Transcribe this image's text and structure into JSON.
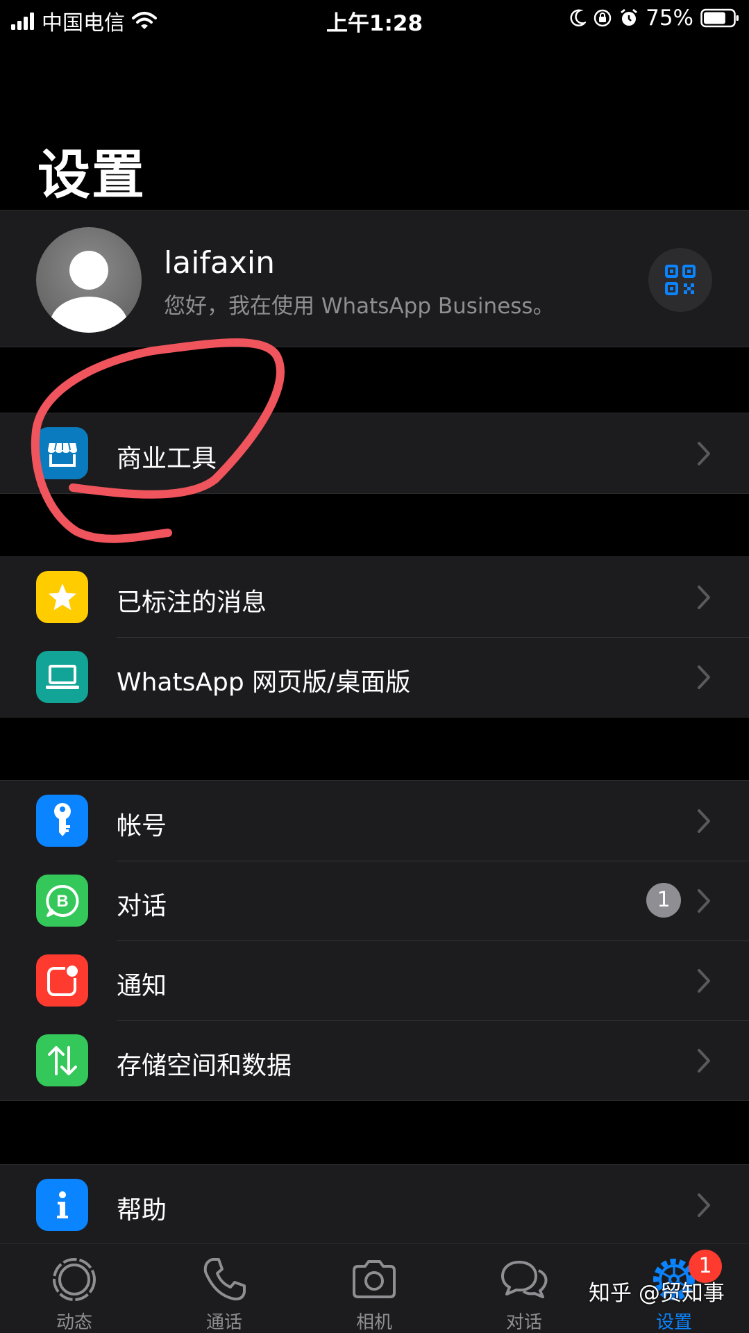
{
  "status_bar": {
    "carrier": "中国电信",
    "time": "上午1:28",
    "battery": "75%",
    "battery_level": 0.75
  },
  "page_title": "设置",
  "profile": {
    "name": "laifaxin",
    "status": "您好，我在使用 WhatsApp Business。",
    "qr_icon": "qr-code-icon"
  },
  "groups": [
    [
      {
        "label": "商业工具",
        "icon": "store-icon",
        "color": "#0a7bbf"
      }
    ],
    [
      {
        "label": "已标注的消息",
        "icon": "star-icon",
        "color": "#ffcc00"
      },
      {
        "label": "WhatsApp 网页版/桌面版",
        "icon": "laptop-icon",
        "color": "#12a497"
      }
    ],
    [
      {
        "label": "帐号",
        "icon": "key-icon",
        "color": "#0a84ff"
      },
      {
        "label": "对话",
        "icon": "whatsapp-business-icon",
        "color": "#34c759",
        "badge": "1"
      },
      {
        "label": "通知",
        "icon": "notification-icon",
        "color": "#ff3b30"
      },
      {
        "label": "存储空间和数据",
        "icon": "data-transfer-icon",
        "color": "#34c759"
      }
    ],
    [
      {
        "label": "帮助",
        "icon": "info-icon",
        "color": "#0a84ff"
      }
    ]
  ],
  "tabs": [
    {
      "label": "动态",
      "icon": "status-icon"
    },
    {
      "label": "通话",
      "icon": "phone-icon"
    },
    {
      "label": "相机",
      "icon": "camera-icon"
    },
    {
      "label": "对话",
      "icon": "chat-icon"
    },
    {
      "label": "设置",
      "icon": "settings-icon",
      "badge": "1",
      "active": true
    }
  ],
  "watermark": "知乎 @贸知事",
  "colors": {
    "accent": "#0a84ff",
    "annotation": "#f0545c",
    "row_background": "#1c1c1e"
  }
}
